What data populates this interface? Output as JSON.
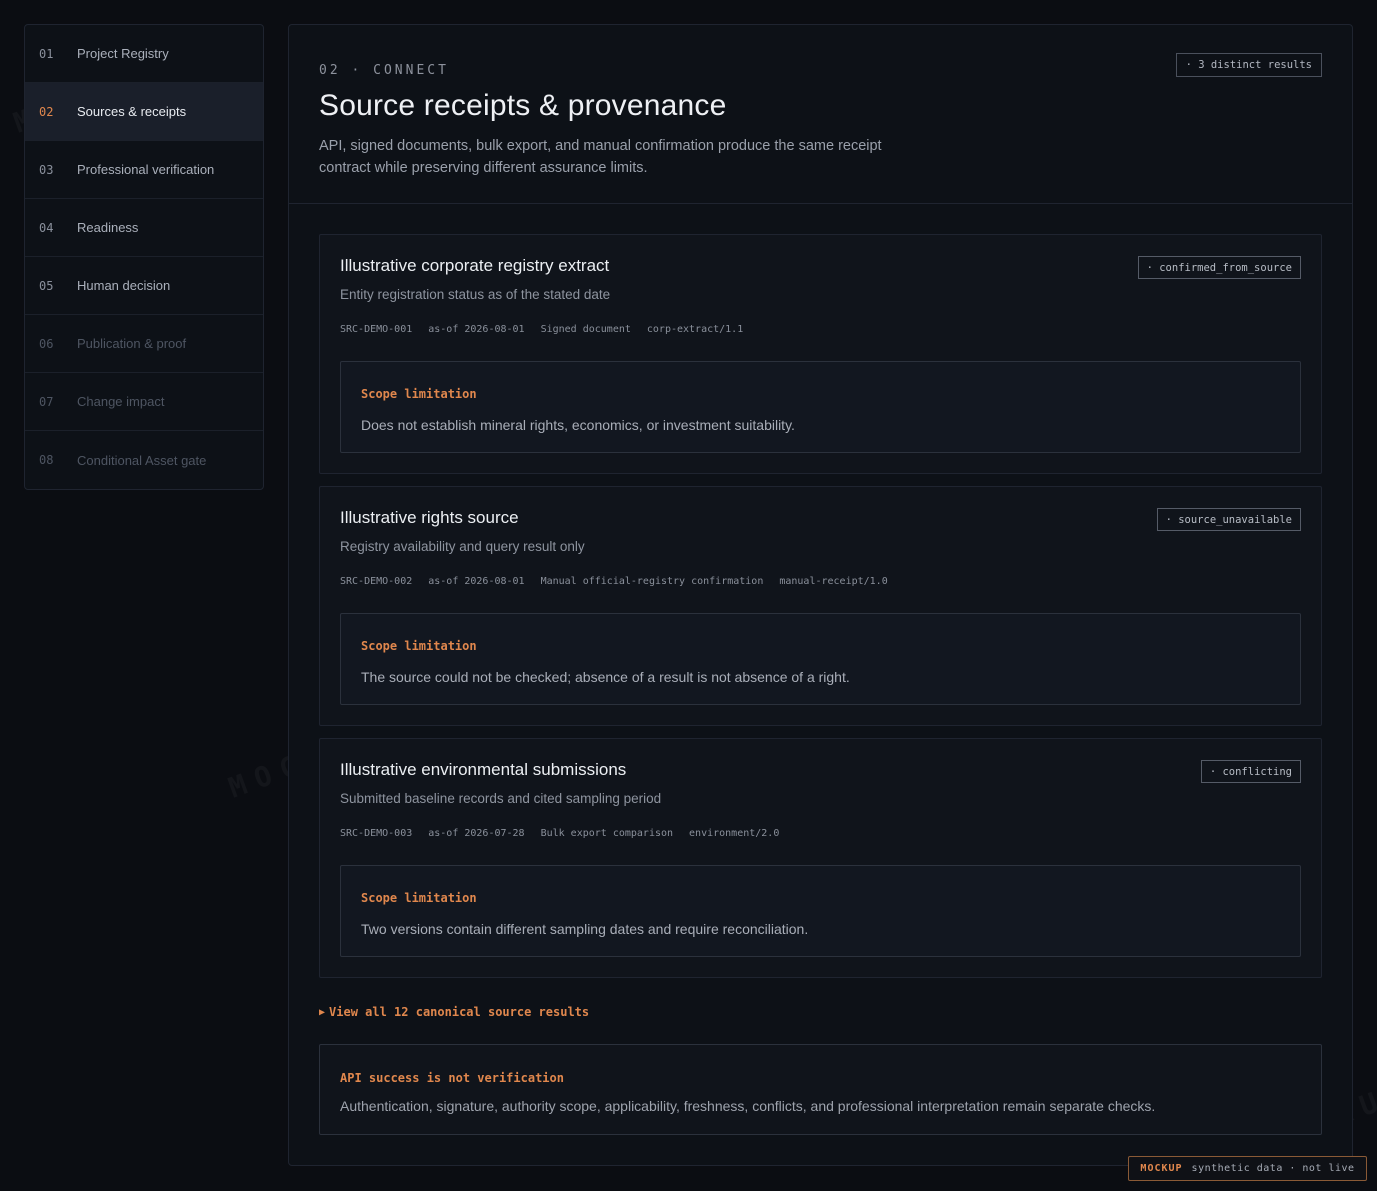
{
  "nav": [
    {
      "num": "01",
      "label": "Project Registry"
    },
    {
      "num": "02",
      "label": "Sources & receipts"
    },
    {
      "num": "03",
      "label": "Professional verification"
    },
    {
      "num": "04",
      "label": "Readiness"
    },
    {
      "num": "05",
      "label": "Human decision"
    },
    {
      "num": "06",
      "label": "Publication & proof"
    },
    {
      "num": "07",
      "label": "Change impact"
    },
    {
      "num": "08",
      "label": "Conditional Asset gate"
    }
  ],
  "header": {
    "eyebrow": "02 · CONNECT",
    "title": "Source receipts & provenance",
    "description": "API, signed documents, bulk export, and manual confirmation produce the same receipt contract while preserving different assurance limits.",
    "count_badge": "· 3 distinct results"
  },
  "cards": [
    {
      "title": "Illustrative corporate registry extract",
      "subtitle": "Entity registration status as of the stated date",
      "status": "· confirmed_from_source",
      "meta": [
        "SRC-DEMO-001",
        "as-of 2026-08-01",
        "Signed document",
        "corp-extract/1.1"
      ],
      "scope_label": "Scope limitation",
      "scope_text": "Does not establish mineral rights, economics, or investment suitability."
    },
    {
      "title": "Illustrative rights source",
      "subtitle": "Registry availability and query result only",
      "status": "· source_unavailable",
      "meta": [
        "SRC-DEMO-002",
        "as-of 2026-08-01",
        "Manual official-registry confirmation",
        "manual-receipt/1.0"
      ],
      "scope_label": "Scope limitation",
      "scope_text": "The source could not be checked; absence of a result is not absence of a right."
    },
    {
      "title": "Illustrative environmental submissions",
      "subtitle": "Submitted baseline records and cited sampling period",
      "status": "· conflicting",
      "meta": [
        "SRC-DEMO-003",
        "as-of 2026-07-28",
        "Bulk export comparison",
        "environment/2.0"
      ],
      "scope_label": "Scope limitation",
      "scope_text": "Two versions contain different sampling dates and require reconciliation."
    }
  ],
  "view_all": "View all 12 canonical source results",
  "note": {
    "title": "API success is not verification",
    "text": "Authentication, signature, authority scope, applicability, freshness, conflicts, and professional interpretation remain separate checks."
  },
  "mockup_tag": {
    "strong": "MOCKUP",
    "rest": "synthetic data · not live"
  },
  "watermark": "MOCKUP",
  "colors": {
    "accent": "#e0874d",
    "background": "#0b0d12",
    "panel": "#0d1117"
  },
  "icons": {
    "view_all": "triangle-right-icon"
  }
}
